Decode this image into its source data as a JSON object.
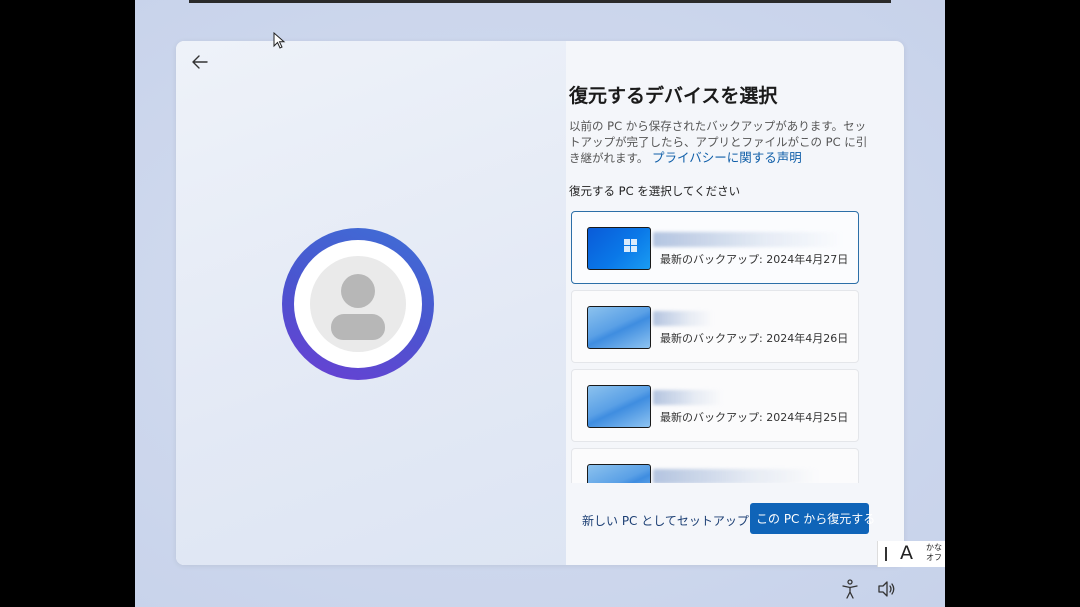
{
  "setup": {
    "title": "復元するデバイスを選択",
    "description": "以前の PC から保存されたバックアップがあります。セットアップが完了したら、アプリとファイルがこの PC に引き継がれます。",
    "privacy_link": "プライバシーに関する声明",
    "choose_label": "復元する PC を選択してください"
  },
  "devices": [
    {
      "subtitle": "最新のバックアップ: 2024年4月27日",
      "selected": true,
      "thumbnail": "windows10-wallpaper"
    },
    {
      "subtitle": "最新のバックアップ: 2024年4月26日",
      "selected": false,
      "thumbnail": "windows11-wallpaper"
    },
    {
      "subtitle": "最新のバックアップ: 2024年4月25日",
      "selected": false,
      "thumbnail": "windows11-wallpaper"
    },
    {
      "subtitle": "",
      "selected": false,
      "thumbnail": "windows11-wallpaper"
    }
  ],
  "buttons": {
    "new_pc": "新しい PC としてセットアップする",
    "restore": "この PC から復元する"
  },
  "ime": {
    "mode_letter": "A",
    "kana_line1": "かな",
    "kana_line2": "オフ"
  },
  "colors": {
    "accent": "#0f64b8",
    "link": "#0f5ea8",
    "selected_border": "#2c6fa8",
    "avatar_ring": "#4a55cf"
  },
  "icons": {
    "back": "arrow-left-icon",
    "accessibility": "accessibility-icon",
    "volume": "speaker-icon"
  }
}
